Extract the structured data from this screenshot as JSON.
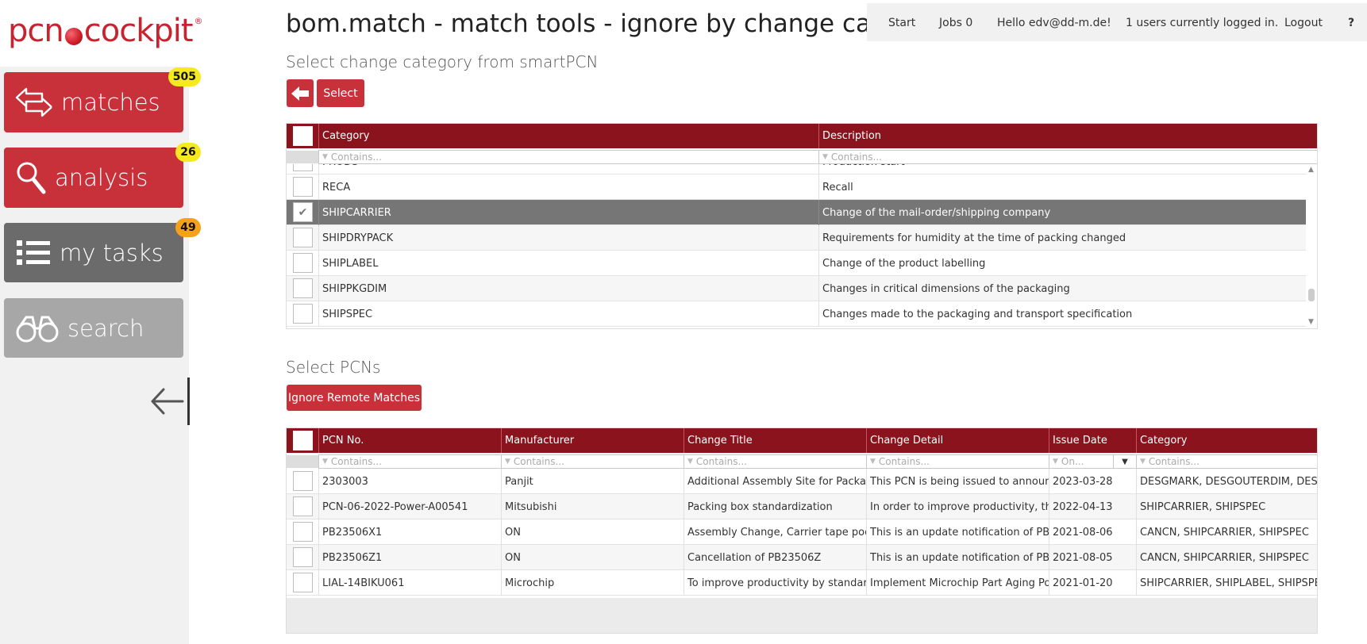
{
  "app": {
    "logo_text_left": "pcn",
    "logo_text_right": "cockpit",
    "logo_reg": "®",
    "page_title": "bom.match - match tools - ignore by change category",
    "accent_color": "#c8313a",
    "header_color": "#8b131d"
  },
  "topnav": {
    "start": "Start",
    "jobs": "Jobs 0",
    "hello": "Hello edv@dd-m.de!",
    "users": "1 users currently logged in.",
    "logout": "Logout",
    "help": "?"
  },
  "sidebar": {
    "matches": {
      "label": "matches",
      "badge": "505",
      "icon": "arrows-exchange-icon"
    },
    "analysis": {
      "label": "analysis",
      "badge": "26",
      "icon": "magnifier-icon"
    },
    "tasks": {
      "label": "my tasks",
      "badge": "49",
      "icon": "list-icon"
    },
    "search": {
      "label": "search",
      "icon": "binoculars-icon"
    },
    "collapse_icon": "arrow-left-icon"
  },
  "category_section": {
    "title": "Select change category from smartPCN",
    "back_icon": "arrow-left-icon",
    "select_label": "Select",
    "columns": {
      "category": "Category",
      "description": "Description"
    },
    "filter_placeholder": "Contains...",
    "partial_row": {
      "category": "PRODS",
      "description": "Production start"
    },
    "rows": [
      {
        "category": "RECA",
        "description": "Recall",
        "checked": false
      },
      {
        "category": "SHIPCARRIER",
        "description": "Change of the mail-order/shipping company",
        "checked": true
      },
      {
        "category": "SHIPDRYPACK",
        "description": "Requirements for humidity at the time of packing changed",
        "checked": false
      },
      {
        "category": "SHIPLABEL",
        "description": "Change of the product labelling",
        "checked": false
      },
      {
        "category": "SHIPPKGDIM",
        "description": "Changes in critical dimensions of the packaging",
        "checked": false
      },
      {
        "category": "SHIPSPEC",
        "description": "Changes made to the packaging and transport specification",
        "checked": false
      }
    ]
  },
  "pcn_section": {
    "title": "Select PCNs",
    "ignore_label": "Ignore Remote Matches",
    "columns": {
      "pcn": "PCN No.",
      "manufacturer": "Manufacturer",
      "title": "Change Title",
      "detail": "Change Detail",
      "date": "Issue Date",
      "category": "Category"
    },
    "filter_contains": "Contains...",
    "filter_on": "On...",
    "rows": [
      {
        "pcn": "2303003",
        "manufacturer": "Panjit",
        "title": "Additional Assembly Site for Package ...",
        "detail": "This PCN is being issued to announce...",
        "date": "2023-03-28",
        "category": "DESGMARK, DESGOUTERDIM, DESG..."
      },
      {
        "pcn": "PCN-06-2022-Power-A00541",
        "manufacturer": "Mitsubishi",
        "title": "Packing box standardization",
        "detail": "In order to improve productivity, the ...",
        "date": "2022-04-13",
        "category": "SHIPCARRIER, SHIPSPEC"
      },
      {
        "pcn": "PB23506X1",
        "manufacturer": "ON",
        "title": "Assembly Change, Carrier tape pocke...",
        "detail": "This is an update notification of PB23...",
        "date": "2021-08-06",
        "category": "CANCN, SHIPCARRIER, SHIPSPEC"
      },
      {
        "pcn": "PB23506Z1",
        "manufacturer": "ON",
        "title": "Cancellation of PB23506Z",
        "detail": "This is an update notification of PB23...",
        "date": "2021-08-05",
        "category": "CANCN, SHIPCARRIER, SHIPSPEC"
      },
      {
        "pcn": "LIAL-14BIKU061",
        "manufacturer": "Microchip",
        "title": "To improve productivity by standardiz...",
        "detail": "Implement Microchip Part Aging Polic...",
        "date": "2021-01-20",
        "category": "SHIPCARRIER, SHIPLABEL, SHIPSPEC"
      }
    ]
  }
}
